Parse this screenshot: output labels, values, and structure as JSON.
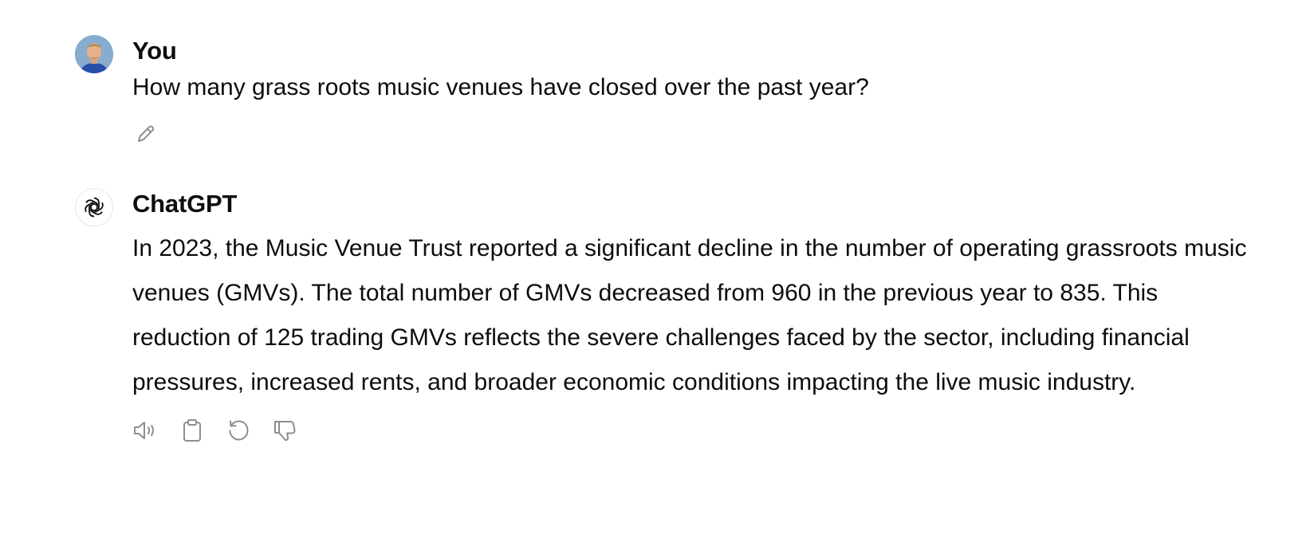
{
  "conversation": {
    "user_message": {
      "author": "You",
      "text": "How many grass roots music venues have closed over the past year?",
      "avatar_icon": "user-photo-avatar",
      "actions": [
        {
          "icon": "pencil-icon",
          "name": "edit-message"
        }
      ]
    },
    "assistant_message": {
      "author": "ChatGPT",
      "text": "In 2023, the Music Venue Trust reported a significant decline in the number of operating grassroots music venues (GMVs). The total number of GMVs decreased from 960 in the previous year to 835. This reduction of 125 trading GMVs reflects the severe challenges faced by the sector, including financial pressures, increased rents, and broader economic conditions impacting the live music industry.",
      "avatar_icon": "openai-logo-icon",
      "actions": [
        {
          "icon": "speaker-icon",
          "name": "read-aloud"
        },
        {
          "icon": "clipboard-icon",
          "name": "copy"
        },
        {
          "icon": "regenerate-icon",
          "name": "regenerate"
        },
        {
          "icon": "thumbs-down-icon",
          "name": "bad-response"
        }
      ]
    }
  },
  "colors": {
    "text": "#0d0d0d",
    "icon": "#8e8e8e",
    "background": "#ffffff"
  }
}
